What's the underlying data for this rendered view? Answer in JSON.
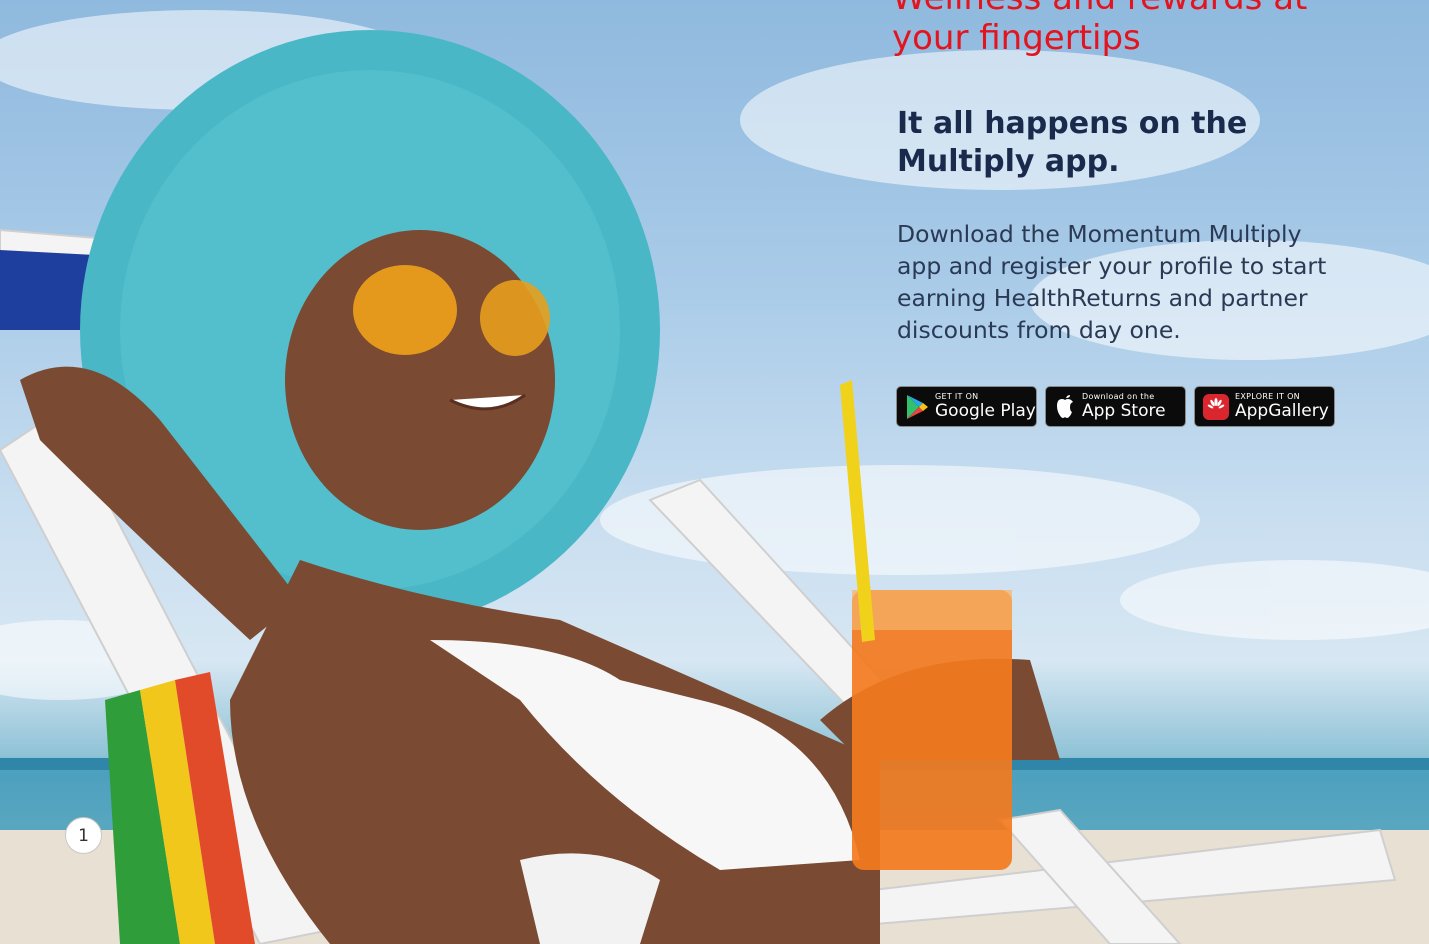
{
  "header": {
    "headline_line1": "Wellness and rewards at",
    "headline_line2": "your fingertips",
    "subheading_line1": "It all happens on the",
    "subheading_line2": "Multiply app.",
    "body_text": "Download the Momentum Multiply app and register your profile to start earning HealthReturns and partner discounts from day one."
  },
  "store_badges": [
    {
      "small": "GET IT ON",
      "big": "Google Play",
      "icon": "google-play-icon"
    },
    {
      "small": "Download on the",
      "big": "App Store",
      "icon": "apple-icon"
    },
    {
      "small": "EXPLORE IT ON",
      "big": "AppGallery",
      "icon": "huawei-icon"
    }
  ],
  "page_number": "1",
  "colors": {
    "headline": "#e3141d",
    "subheading": "#1a2a4c",
    "body": "#2a3a55",
    "badge_bg": "#0b0b0b"
  }
}
